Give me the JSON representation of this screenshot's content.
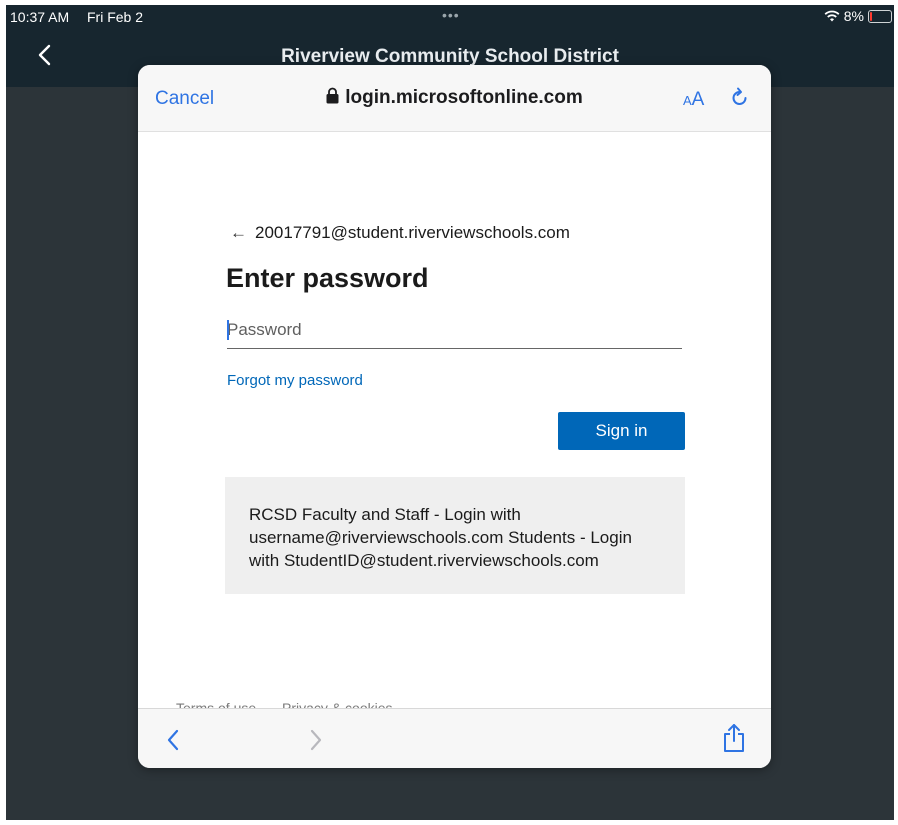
{
  "status_bar": {
    "time": "10:37 AM",
    "date": "Fri Feb 2",
    "dots": "•••",
    "battery": "8%"
  },
  "app": {
    "title": "Riverview Community School District"
  },
  "browser": {
    "cancel_label": "Cancel",
    "url": "login.microsoftonline.com",
    "text_size_small": "A",
    "text_size_large": "A"
  },
  "signin": {
    "back_arrow": "←",
    "email": "20017791@student.riverviewschools.com",
    "heading": "Enter password",
    "password_placeholder": "Password",
    "forgot_link": "Forgot my password",
    "signin_button": "Sign in",
    "info_text": "RCSD Faculty and Staff - Login with username@riverviewschools.com Students - Login with StudentID@student.riverviewschools.com"
  },
  "footer": {
    "terms": "Terms of use",
    "privacy": "Privacy & cookies"
  },
  "colors": {
    "accent": "#0067b8",
    "ios_blue": "#2f74e3",
    "app_bar": "#17262f"
  }
}
